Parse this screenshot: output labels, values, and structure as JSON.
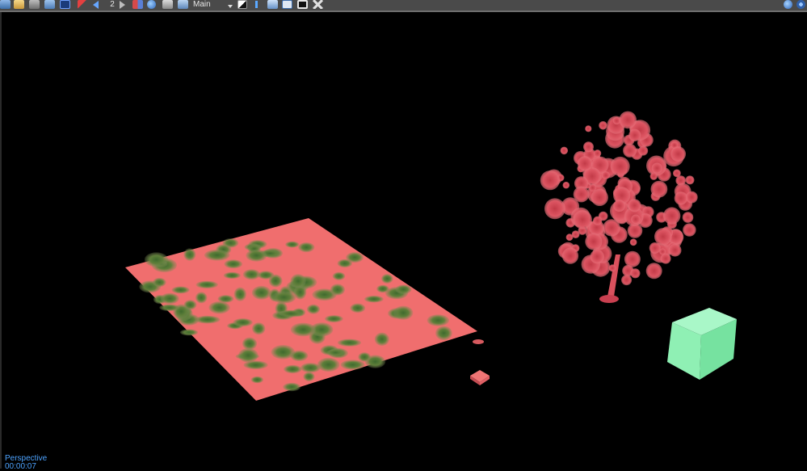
{
  "toolbar": {
    "spinner_value": "2",
    "channel_label": "Main",
    "icons": [
      "save-icon",
      "open-icon",
      "render-icon",
      "cache-icon",
      "photoshop-icon",
      "pen-icon",
      "layer-icon",
      "prev-arrow-icon",
      "next-arrow-icon",
      "ab-compare-icon",
      "globe-icon",
      "histogram-icon",
      "channel-icon",
      "grayscale-icon",
      "info-icon",
      "history-icon",
      "frame-icon",
      "tools-icon",
      "globe-right-icon"
    ]
  },
  "colors": {
    "toolbar_bg": "#4a4a4a",
    "viewport_bg": "#000000",
    "status_text": "#4da3ff",
    "plane": "#f06e6e",
    "tree": "#d94a55",
    "cube": "#8ff0b4"
  },
  "viewport": {
    "view_label": "Perspective",
    "timecode": "00:00:07"
  }
}
